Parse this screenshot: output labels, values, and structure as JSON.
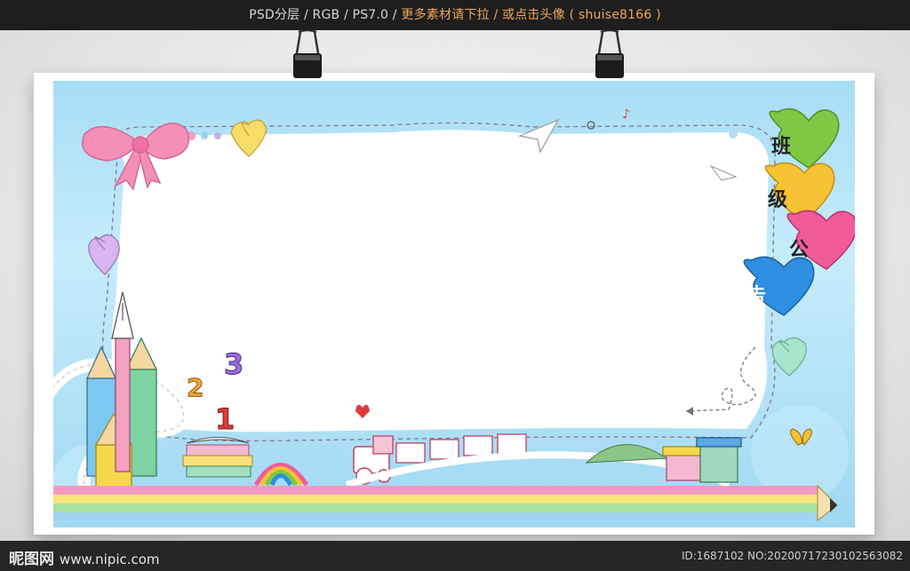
{
  "header": {
    "left_text": "PSD分层 / RGB / PS7.0 /",
    "promo_text": "更多素材请下拉 / 或点击头像",
    "author_text": "( shuise8166 )"
  },
  "board": {
    "title_chars": [
      "班",
      "级",
      "公",
      "告"
    ],
    "numbers": [
      "1",
      "2",
      "3"
    ],
    "heart_colors": [
      "#7dc943",
      "#f7c233",
      "#f25b9a",
      "#2f8fe0"
    ]
  },
  "footer": {
    "brand": "昵图网",
    "domain": "www.nipic.com",
    "id_text": "ID:1687102 NO:20200717230102563082"
  }
}
